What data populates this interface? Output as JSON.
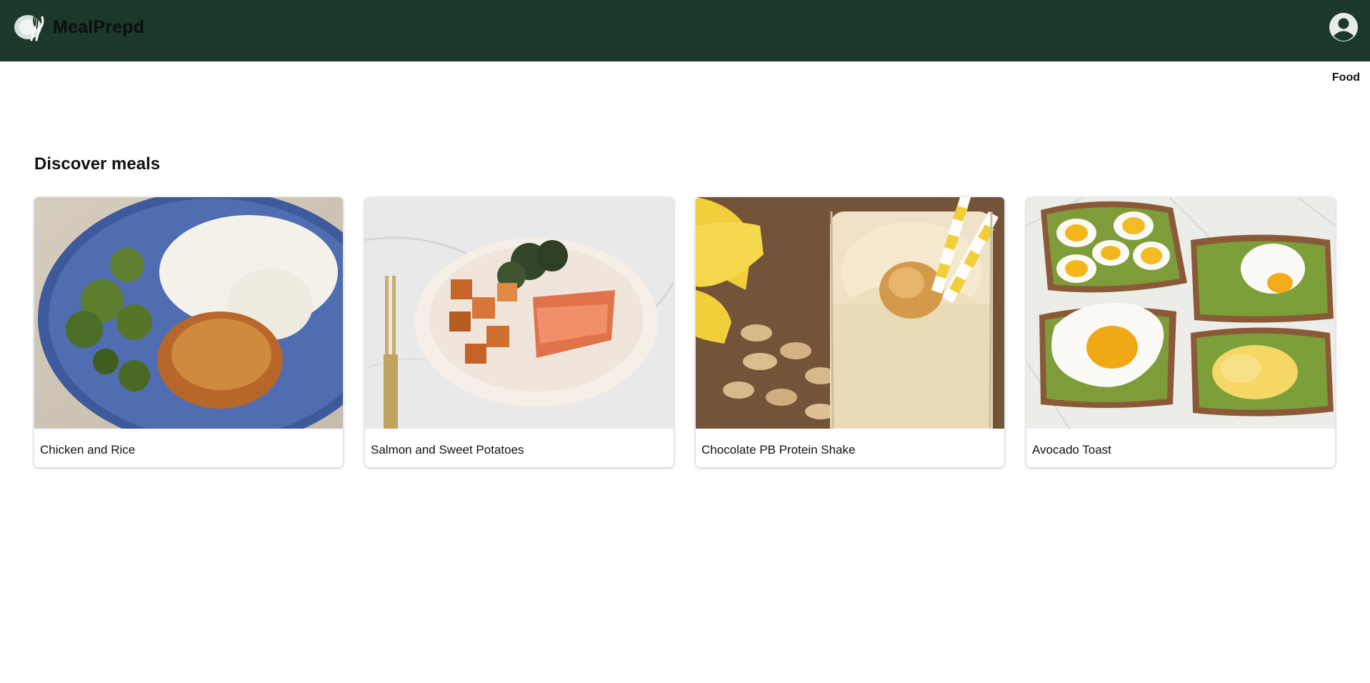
{
  "app": {
    "brand": "MealPrepd"
  },
  "header": {
    "logo_icon": "plate-utensils-icon",
    "profile_icon": "user-circle-icon",
    "background": "#1b382b"
  },
  "nav": {
    "food_label": "Food"
  },
  "main": {
    "title": "Discover meals",
    "meals": [
      {
        "name": "Chicken and Rice",
        "image": "chicken-rice-photo"
      },
      {
        "name": "Salmon and Sweet Potatoes",
        "image": "salmon-sweet-potatoes-photo"
      },
      {
        "name": "Chocolate PB Protein Shake",
        "image": "protein-shake-photo"
      },
      {
        "name": "Avocado Toast",
        "image": "avocado-toast-photo"
      }
    ]
  }
}
